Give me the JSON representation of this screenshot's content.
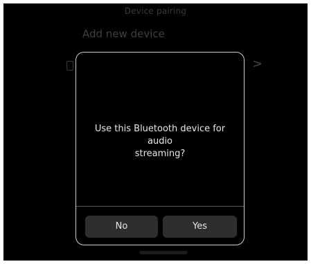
{
  "background": {
    "title": "Device pairing",
    "heading": "Add new device",
    "phone_icon": "phone-icon",
    "chevron_icon": "chevron-right-icon",
    "chevron_glyph": ">"
  },
  "dialog": {
    "message_line1": "Use this Bluetooth device for audio",
    "message_line2": "streaming?",
    "no_label": "No",
    "yes_label": "Yes"
  },
  "colors": {
    "screen_bg": "#000000",
    "dialog_border": "#d0d0d0",
    "button_bg": "#2e2e2e",
    "text": "#e8e8e8"
  }
}
